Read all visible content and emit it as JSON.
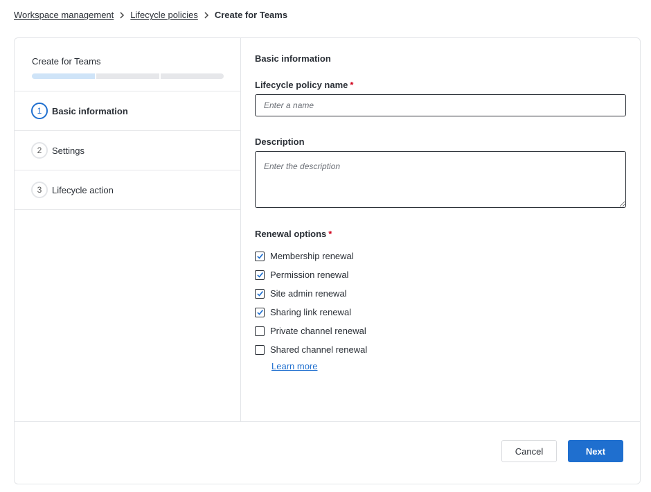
{
  "breadcrumb": {
    "items": [
      "Workspace management",
      "Lifecycle policies"
    ],
    "current": "Create for Teams"
  },
  "wizard": {
    "title": "Create for Teams",
    "progress": {
      "current_step": 1,
      "total_steps": 3
    },
    "steps": [
      {
        "number": "1",
        "label": "Basic information"
      },
      {
        "number": "2",
        "label": "Settings"
      },
      {
        "number": "3",
        "label": "Lifecycle action"
      }
    ]
  },
  "form": {
    "section_title": "Basic information",
    "name_label": "Lifecycle policy name",
    "name_required": "*",
    "name_placeholder": "Enter a name",
    "name_value": "",
    "description_label": "Description",
    "description_placeholder": "Enter the description",
    "description_value": "",
    "renewal_label": "Renewal options",
    "renewal_required": "*",
    "renewal_options": [
      {
        "label": "Membership renewal",
        "checked": true
      },
      {
        "label": "Permission renewal",
        "checked": true
      },
      {
        "label": "Site admin renewal",
        "checked": true
      },
      {
        "label": "Sharing link renewal",
        "checked": true
      },
      {
        "label": "Private channel renewal",
        "checked": false
      },
      {
        "label": "Shared channel renewal",
        "checked": false
      }
    ],
    "learn_more": "Learn more"
  },
  "footer": {
    "cancel_label": "Cancel",
    "next_label": "Next"
  },
  "colors": {
    "accent": "#1f6fcf",
    "required": "#d0021b",
    "progress_done": "#cfe4f8",
    "progress_todo": "#e6e7ea"
  }
}
